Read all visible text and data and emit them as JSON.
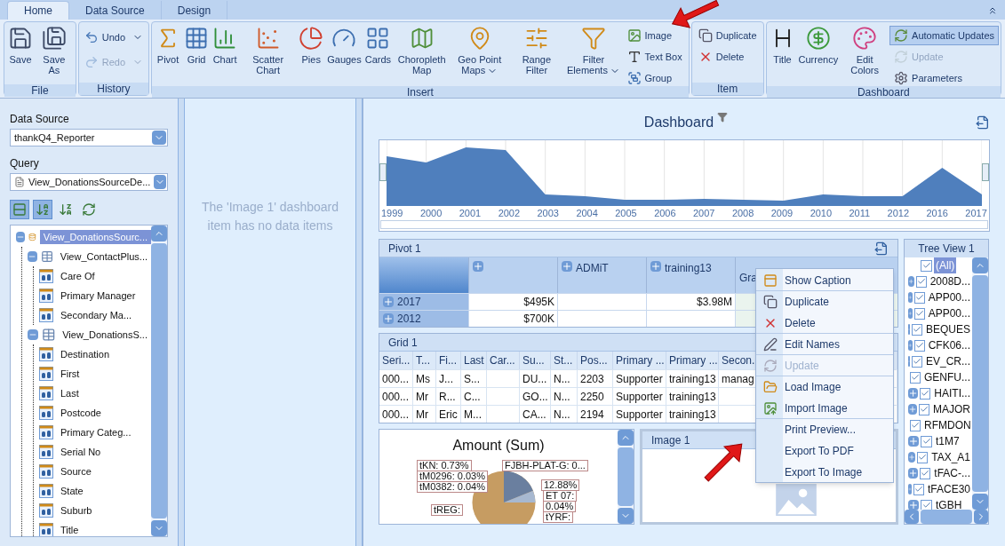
{
  "ribbon": {
    "tabs": [
      {
        "label": "Home",
        "selected": true
      },
      {
        "label": "Data Source",
        "selected": false
      },
      {
        "label": "Design",
        "selected": false
      }
    ],
    "groups": [
      {
        "label": "File",
        "items": [
          {
            "label": "Save",
            "kind": "large",
            "disabled": false
          },
          {
            "label": "Save As",
            "kind": "large",
            "disabled": false
          }
        ]
      },
      {
        "label": "History",
        "items": [
          {
            "label": "Undo",
            "kind": "split",
            "disabled": false
          },
          {
            "label": "Redo",
            "kind": "split",
            "disabled": true
          }
        ]
      },
      {
        "label": "Insert",
        "items": [
          {
            "label": "Pivot",
            "kind": "large",
            "disabled": false
          },
          {
            "label": "Grid",
            "kind": "large",
            "disabled": false
          },
          {
            "label": "Chart",
            "kind": "large",
            "disabled": false
          },
          {
            "label": "Scatter Chart",
            "kind": "large",
            "disabled": false
          },
          {
            "label": "Pies",
            "kind": "large",
            "disabled": false
          },
          {
            "label": "Gauges",
            "kind": "large",
            "disabled": false
          },
          {
            "label": "Cards",
            "kind": "large",
            "disabled": false
          },
          {
            "label": "Choropleth Map",
            "kind": "large",
            "disabled": false
          },
          {
            "label": "Geo Point Maps",
            "kind": "dropdown",
            "disabled": false
          },
          {
            "label": "Range Filter",
            "kind": "large",
            "disabled": false
          },
          {
            "label": "Filter Elements",
            "kind": "dropdown",
            "disabled": false
          },
          {
            "label": "Image",
            "kind": "small",
            "disabled": false
          },
          {
            "label": "Text Box",
            "kind": "small",
            "disabled": false
          },
          {
            "label": "Group",
            "kind": "small",
            "disabled": false
          }
        ]
      },
      {
        "label": "Item",
        "items": [
          {
            "label": "Duplicate",
            "kind": "small",
            "disabled": false
          },
          {
            "label": "Delete",
            "kind": "small",
            "disabled": false
          }
        ]
      },
      {
        "label": "Dashboard",
        "items": [
          {
            "label": "Title",
            "kind": "large",
            "disabled": false
          },
          {
            "label": "Currency",
            "kind": "large",
            "disabled": false
          },
          {
            "label": "Edit Colors",
            "kind": "large",
            "disabled": false
          },
          {
            "label": "Automatic Updates",
            "kind": "toggle",
            "disabled": false,
            "selected": true
          },
          {
            "label": "Update",
            "kind": "small",
            "disabled": true
          },
          {
            "label": "Parameters",
            "kind": "small",
            "disabled": false
          }
        ]
      }
    ]
  },
  "data_panel": {
    "data_source": {
      "label": "Data Source",
      "value": "thankQ4_Reporter"
    },
    "query": {
      "label": "Query",
      "value": "View_DonationsSourceDe..."
    },
    "toolbar": [
      {
        "selected": true
      },
      {
        "selected": true
      },
      {
        "selected": false
      },
      {
        "selected": false
      }
    ],
    "fields": [
      {
        "label": "View_DonationsSourc...",
        "kind": "source",
        "selected": true,
        "expanded": true,
        "children": [
          {
            "label": "View_ContactPlus...",
            "kind": "table",
            "selected": false,
            "expanded": true,
            "children": [
              {
                "label": "Care Of",
                "kind": "field",
                "selected": false
              },
              {
                "label": "Primary Manager",
                "kind": "field",
                "selected": false
              },
              {
                "label": "Secondary Ma...",
                "kind": "field",
                "selected": false
              }
            ]
          },
          {
            "label": "View_DonationsS...",
            "kind": "table",
            "selected": false,
            "expanded": true,
            "children": [
              {
                "label": "Destination",
                "kind": "field",
                "selected": false
              },
              {
                "label": "First",
                "kind": "field",
                "selected": false
              },
              {
                "label": "Last",
                "kind": "field",
                "selected": false
              },
              {
                "label": "Postcode",
                "kind": "field",
                "selected": false
              },
              {
                "label": "Primary Categ...",
                "kind": "field",
                "selected": false
              },
              {
                "label": "Serial No",
                "kind": "field",
                "selected": false
              },
              {
                "label": "Source",
                "kind": "field",
                "selected": false
              },
              {
                "label": "State",
                "kind": "field",
                "selected": false
              },
              {
                "label": "Suburb",
                "kind": "field",
                "selected": false
              },
              {
                "label": "Title",
                "kind": "field",
                "selected": false
              }
            ]
          }
        ]
      }
    ]
  },
  "item_panel": {
    "message": "The 'Image 1' dashboard item has no data items"
  },
  "dashboard": {
    "title": "Dashboard",
    "range_filter": {
      "years": [
        "1999",
        "2000",
        "2001",
        "2002",
        "2003",
        "2004",
        "2005",
        "2006",
        "2007",
        "2008",
        "2009",
        "2010",
        "2011",
        "2012",
        "2016",
        "2017"
      ]
    },
    "pivot": {
      "title": "Pivot 1",
      "columns": [
        {
          "expandable": true
        },
        {
          "label": "ADMiT",
          "expandable": true
        },
        {
          "label": "training13",
          "expandable": true
        },
        {
          "label": "Gra",
          "expandable": false
        }
      ],
      "rows": [
        {
          "label": "2017",
          "cells": [
            "$495K",
            null,
            "$3.98M",
            null
          ]
        },
        {
          "label": "2012",
          "cells": [
            "$700K",
            null,
            null,
            null
          ]
        }
      ]
    },
    "grid": {
      "title": "Grid 1",
      "columns": [
        "Seri...",
        "T...",
        "Fi...",
        "Last",
        "Car...",
        "Su...",
        "St...",
        "Pos...",
        "Primary ...",
        "Primary ...",
        "Secon."
      ],
      "rows": [
        [
          "000...",
          "Ms",
          "J...",
          "S...",
          null,
          "DU...",
          "N...",
          "2203",
          "Supporter",
          "training13",
          "manag"
        ],
        [
          "000...",
          "Mr",
          "R...",
          "C...",
          null,
          "GO...",
          "N...",
          "2250",
          "Supporter",
          "training13",
          null
        ],
        [
          "000...",
          "Mr",
          "Eric",
          "M...",
          null,
          "CA...",
          "N...",
          "2194",
          "Supporter",
          "training13",
          null
        ]
      ]
    },
    "pie": {
      "title": "Amount (Sum)",
      "labels": [
        "tKN: 0.73%",
        "tM0296: 0.03%",
        "tM0382: 0.04%",
        "FJBH-PLAT-G: 0...",
        "12.88%",
        "ET 07:",
        "0.04%",
        "tREG:",
        "tYRF:"
      ]
    },
    "image": {
      "title": "Image 1"
    },
    "tree_view": {
      "title": "Tree View 1",
      "items": [
        {
          "label": "(All)",
          "kind": "all",
          "checked": true,
          "selected": true
        },
        {
          "label": "2008D...",
          "kind": "group",
          "checked": true,
          "selected": false
        },
        {
          "label": "APP00...",
          "kind": "group",
          "checked": true,
          "selected": false
        },
        {
          "label": "APP00...",
          "kind": "group",
          "checked": true,
          "selected": false
        },
        {
          "label": "BEQUES",
          "kind": "group",
          "checked": true,
          "selected": false
        },
        {
          "label": "CFK06...",
          "kind": "group",
          "checked": true,
          "selected": false
        },
        {
          "label": "EV_CR...",
          "kind": "group",
          "checked": true,
          "selected": false
        },
        {
          "label": "GENFU...",
          "kind": "group",
          "checked": true,
          "selected": false
        },
        {
          "label": "HAITI...",
          "kind": "group",
          "checked": true,
          "selected": false
        },
        {
          "label": "MAJOR",
          "kind": "group",
          "checked": true,
          "selected": false
        },
        {
          "label": "RFMDON",
          "kind": "group",
          "checked": true,
          "selected": false
        },
        {
          "label": "t1M7",
          "kind": "group",
          "checked": true,
          "selected": false
        },
        {
          "label": "TAX_A1",
          "kind": "group",
          "checked": true,
          "selected": false
        },
        {
          "label": "tFAC-...",
          "kind": "group",
          "checked": true,
          "selected": false
        },
        {
          "label": "tFACE30",
          "kind": "group",
          "checked": true,
          "selected": false
        },
        {
          "label": "tGBH",
          "kind": "group",
          "checked": true,
          "selected": false
        }
      ]
    }
  },
  "context_menu": {
    "items": [
      {
        "label": "Show Caption",
        "disabled": false,
        "separator_before": false
      },
      {
        "label": "Duplicate",
        "disabled": false,
        "separator_before": true
      },
      {
        "label": "Delete",
        "disabled": false,
        "separator_before": false
      },
      {
        "label": "Edit Names",
        "disabled": false,
        "separator_before": true
      },
      {
        "label": "Update",
        "disabled": true,
        "separator_before": true
      },
      {
        "label": "Load Image",
        "disabled": false,
        "separator_before": true
      },
      {
        "label": "Import Image",
        "disabled": false,
        "separator_before": false
      },
      {
        "label": "Print Preview...",
        "disabled": false,
        "separator_before": true
      },
      {
        "label": "Export To PDF",
        "disabled": false,
        "separator_before": false
      },
      {
        "label": "Export To Image",
        "disabled": false,
        "separator_before": false
      }
    ]
  }
}
